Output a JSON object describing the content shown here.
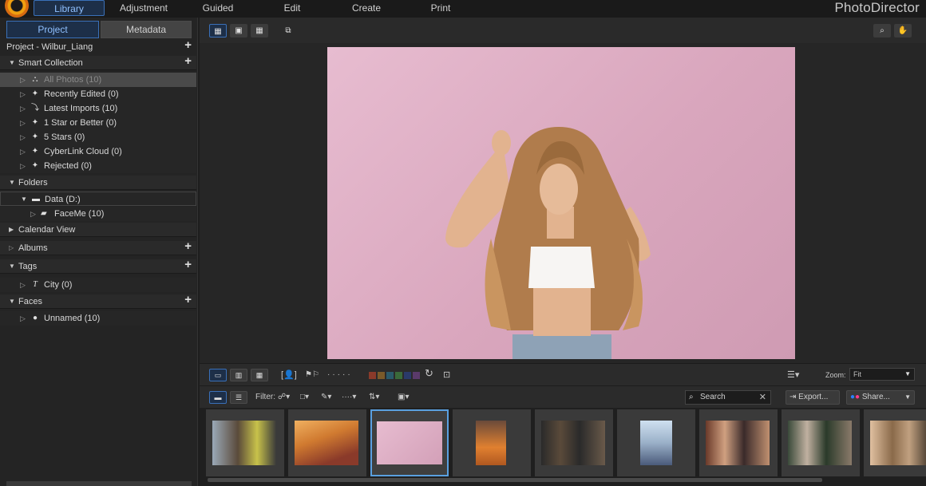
{
  "app": {
    "brand": "PhotoDirector",
    "tabs": [
      {
        "label": "Library",
        "active": true
      },
      {
        "label": "Adjustment"
      },
      {
        "label": "Guided"
      },
      {
        "label": "Edit"
      },
      {
        "label": "Create"
      },
      {
        "label": "Print"
      }
    ]
  },
  "left_panel": {
    "tabs": {
      "project": "Project",
      "metadata": "Metadata"
    },
    "project_name": "Project - Wilbur_Liang",
    "smart_collection": {
      "label": "Smart Collection",
      "items": [
        {
          "label": "All Photos (10)",
          "icon": "hierarchy-icon"
        },
        {
          "label": "Recently Edited (0)",
          "icon": "sparkle-icon"
        },
        {
          "label": "Latest Imports (10)",
          "icon": "import-icon"
        },
        {
          "label": "1 Star or Better (0)",
          "icon": "sparkle-icon"
        },
        {
          "label": "5 Stars (0)",
          "icon": "sparkle-icon"
        },
        {
          "label": "CyberLink Cloud (0)",
          "icon": "sparkle-icon"
        },
        {
          "label": "Rejected (0)",
          "icon": "sparkle-icon"
        }
      ]
    },
    "folders": {
      "label": "Folders",
      "drive": "Data (D:)",
      "folder": "FaceMe (10)"
    },
    "calendar": "Calendar View",
    "albums": "Albums",
    "tags": {
      "label": "Tags",
      "items": [
        "City (0)"
      ]
    },
    "faces": {
      "label": "Faces",
      "items": [
        "Unnamed (10)"
      ]
    }
  },
  "browser_bar": {
    "zoom_label": "Zoom:",
    "zoom_value": "Fit"
  },
  "filter_bar": {
    "filter_label": "Filter:",
    "search_placeholder": "Search",
    "export_label": "Export...",
    "share_label": "Share..."
  },
  "colors": {
    "accent": "#3a70b8",
    "swatches": [
      "#8a3a2a",
      "#7a5a2a",
      "#2a5a6a",
      "#3a6a3a",
      "#2a3a6a",
      "#5a3a6a"
    ]
  },
  "filmstrip": {
    "count": 9,
    "selected_index": 2
  }
}
